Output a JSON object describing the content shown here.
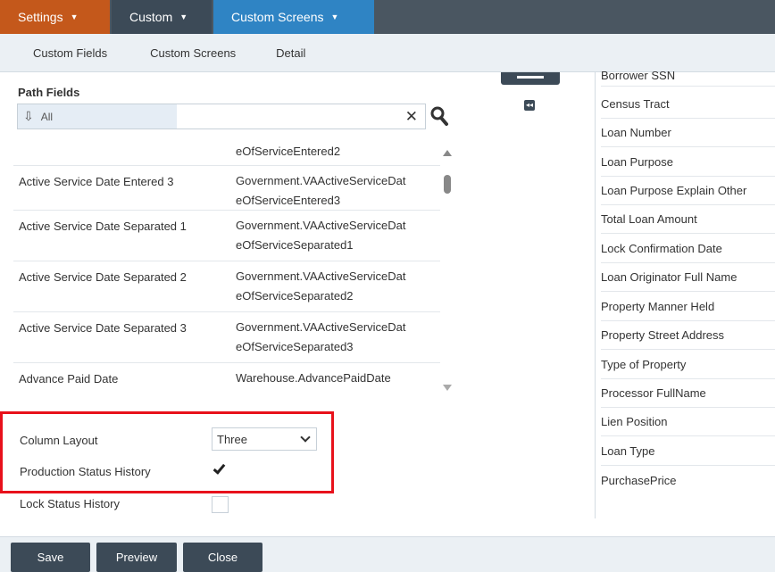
{
  "nav": {
    "tabs": [
      {
        "label": "Settings"
      },
      {
        "label": "Custom"
      },
      {
        "label": "Custom Screens"
      }
    ]
  },
  "subnav": {
    "items": [
      "Custom Fields",
      "Custom Screens",
      "Detail"
    ]
  },
  "path_fields": {
    "label": "Path Fields",
    "filter_value": "All",
    "rows": [
      {
        "name": "",
        "path": "eOfServiceEntered2"
      },
      {
        "name": "Active Service Date Entered 3",
        "path": "Government.VAActiveServiceDateOfServiceEntered3"
      },
      {
        "name": "Active Service Date Separated 1",
        "path": "Government.VAActiveServiceDateOfServiceSeparated1"
      },
      {
        "name": "Active Service Date Separated 2",
        "path": "Government.VAActiveServiceDateOfServiceSeparated2"
      },
      {
        "name": "Active Service Date Separated 3",
        "path": "Government.VAActiveServiceDateOfServiceSeparated3"
      },
      {
        "name": "Advance Paid Date",
        "path": "Warehouse.AdvancePaidDate"
      }
    ],
    "rows_display": [
      {
        "name": "",
        "path1": "eOfServiceEntered2",
        "path2": ""
      },
      {
        "name": "Active Service Date Entered 3",
        "path1": "Government.VAActiveServiceDat",
        "path2": "eOfServiceEntered3"
      },
      {
        "name": "Active Service Date Separated 1",
        "path1": "Government.VAActiveServiceDat",
        "path2": "eOfServiceSeparated1"
      },
      {
        "name": "Active Service Date Separated 2",
        "path1": "Government.VAActiveServiceDat",
        "path2": "eOfServiceSeparated2"
      },
      {
        "name": "Active Service Date Separated 3",
        "path1": "Government.VAActiveServiceDat",
        "path2": "eOfServiceSeparated3"
      },
      {
        "name": "Advance Paid Date",
        "path1": "Warehouse.AdvancePaidDate",
        "path2": ""
      }
    ]
  },
  "selected_fields": [
    "Borrower SSN",
    "Census Tract",
    "Loan Number",
    "Loan Purpose",
    "Loan Purpose Explain Other",
    "Total Loan Amount",
    "Lock Confirmation Date",
    "Loan Originator Full Name",
    "Property Manner Held",
    "Property Street Address",
    "Type of Property",
    "Processor FullName",
    "Lien Position",
    "Loan Type",
    "PurchasePrice"
  ],
  "options": {
    "column_layout_label": "Column Layout",
    "column_layout_value": "Three",
    "production_status_label": "Production Status History",
    "production_status_checked": true,
    "lock_status_label": "Lock Status History",
    "lock_status_checked": false
  },
  "footer": {
    "save": "Save",
    "preview": "Preview",
    "close": "Close"
  },
  "colors": {
    "settings_tab": "#c4581b",
    "custom_tab": "#3c4a57",
    "screens_tab": "#2f84c4",
    "highlight": "#e8111b"
  }
}
